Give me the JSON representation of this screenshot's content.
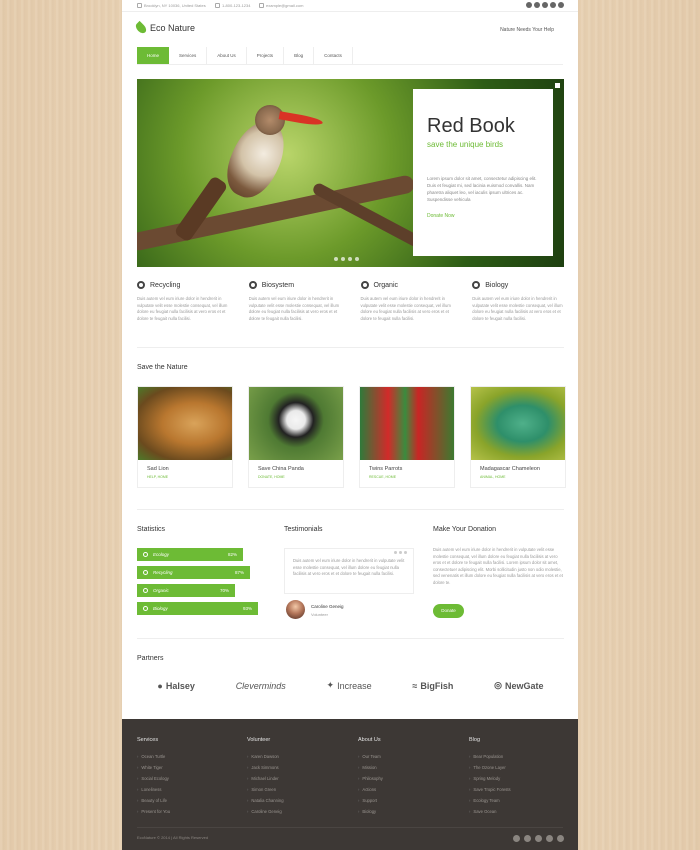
{
  "topbar": {
    "address": "Brooklyn, NY 10036, United States",
    "phone": "1-800-123-1234",
    "email": "example@gmail.com"
  },
  "header": {
    "logo": "Eco Nature",
    "tagline": "Nature Needs Your Help"
  },
  "nav": [
    "Home",
    "Services",
    "About Us",
    "Projects",
    "Blog",
    "Contacts"
  ],
  "hero": {
    "title": "Red Book",
    "subtitle": "save the unique birds",
    "text": "Lorem ipsum dolor sit amet, consectetur adipiscing elit. Duis et feugiat mi, sed lacinia euismod convallis. Nam pharetra aliquet leo, vel iaculis ipsum ultrices ac. Suspendisse vehicula",
    "link": "Donate Now"
  },
  "features": [
    {
      "icon": "recycle-icon",
      "title": "Recycling",
      "text": "Duis autem vel eum iriure dolor in hendrerit in vulputate velit esse molestie consequat, vel illum dolore eu feugiat nulla facilisis at vero eros et et dolore te feugait nulla facilisi."
    },
    {
      "icon": "globe-icon",
      "title": "Biosystem",
      "text": "Duis autem vel eum iriure dolor in hendrerit in vulputate velit esse molestie consequat, vel illum dolore eu feugiat nulla facilisis at vero eros et et dolore te feugait nulla facilisi."
    },
    {
      "icon": "leaf-icon",
      "title": "Organic",
      "text": "Duis autem vel eum iriure dolor in hendrerit in vulputate velit esse molestie consequat, vel illum dolore eu feugiat nulla facilisis at vero eros et et dolore te feugait nulla facilisi."
    },
    {
      "icon": "drop-icon",
      "title": "Biology",
      "text": "Duis autem vel eum iriure dolor in hendrerit in vulputate velit esse molestie consequat, vel illum dolore eu feugiat nulla facilisis at vero eros et et dolore te feugait nulla facilisi."
    }
  ],
  "save_nature": {
    "title": "Save the Nature",
    "items": [
      {
        "name": "Sad Lion",
        "meta": "HELP, HOME"
      },
      {
        "name": "Save China Panda",
        "meta": "DONATE, HOME"
      },
      {
        "name": "Twins Parrots",
        "meta": "RESCUE, HOME"
      },
      {
        "name": "Madagascar Chameleon",
        "meta": "ANIMAL, HOME"
      }
    ]
  },
  "statistics": {
    "title": "Statistics",
    "bars": [
      {
        "label": "Ecology",
        "value": "82%"
      },
      {
        "label": "Recycling",
        "value": "87%"
      },
      {
        "label": "Organic",
        "value": "70%"
      },
      {
        "label": "Biology",
        "value": "93%"
      }
    ]
  },
  "testimonials": {
    "title": "Testimonials",
    "quote": "Duis autem vel eum iriure dolor in hendrerit in vulputate velit esse molestie consequat, vel illum dolore eu feugiat nulla facilisis at vero eros et et dolore te feugait nulla facilisi.",
    "name": "Caroline Geneig",
    "role": "Volunteer"
  },
  "donation": {
    "title": "Make Your Donation",
    "text": "Duis autem vel eum iriure dolor in hendrerit in vulputate velit esse molestie consequat, vel illum dolore eu feugiat nulla facilisis at vero eros et et dolore te feugait nulla facilisi. Lorem ipsum dolor sit amet, consectetuer adipiscing elit. Morbi sollicitudin justo non odio molestie, sed venenatis et illum dolore eu feugiat nulla facilisis at vero eros et et dolore te.",
    "button": "Donate"
  },
  "partners": {
    "title": "Partners",
    "items": [
      "Halsey",
      "Cleverminds",
      "Increase",
      "BigFish",
      "NewGate"
    ]
  },
  "footer": {
    "columns": [
      {
        "title": "Services",
        "items": [
          "Ocean Turtle",
          "White Tiger",
          "Social Ecology",
          "Loneliness",
          "Beauty of Life",
          "Present for You"
        ]
      },
      {
        "title": "Volunteer",
        "items": [
          "Karen Dawson",
          "Jack Simmons",
          "Michael Linder",
          "Simon Green",
          "Natalia Channing",
          "Caroline Geneig"
        ]
      },
      {
        "title": "About Us",
        "items": [
          "Our Team",
          "Mission",
          "Philosophy",
          "Actions",
          "Support",
          "Biology"
        ]
      },
      {
        "title": "Blog",
        "items": [
          "Bear Population",
          "The Ozone Layer",
          "Spring Melody",
          "Save Tropic Forests",
          "Ecology Team",
          "Save Ocean"
        ]
      }
    ],
    "copyright": "EcoNature © 2014 | All Rights Reserved"
  },
  "colors": {
    "accent": "#6dbb35",
    "footer": "#3d3835"
  }
}
